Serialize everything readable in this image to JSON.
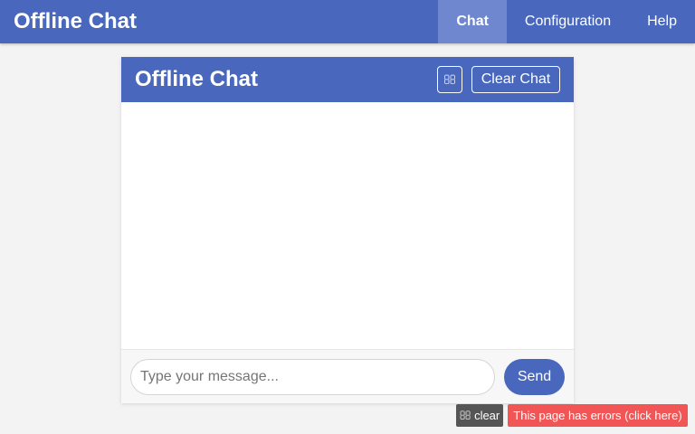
{
  "app": {
    "title": "Offline Chat"
  },
  "nav": {
    "items": [
      {
        "label": "Chat",
        "active": true
      },
      {
        "label": "Configuration",
        "active": false
      },
      {
        "label": "Help",
        "active": false
      }
    ]
  },
  "chat": {
    "title": "Offline Chat",
    "icon_button": {
      "icon": "missing-glyph-icon",
      "glyph": ""
    },
    "clear_label": "Clear Chat",
    "messages": [],
    "input": {
      "placeholder": "Type your message...",
      "value": ""
    },
    "send_label": "Send"
  },
  "error_bar": {
    "clear_icon_glyph": "",
    "clear_label": "clear",
    "message": "This page has errors (click here)"
  },
  "colors": {
    "primary": "#4867bd",
    "nav_active": "#6e87cf",
    "page_bg": "#f3f3f3",
    "error": "#f25555",
    "dark_badge": "#555555"
  }
}
